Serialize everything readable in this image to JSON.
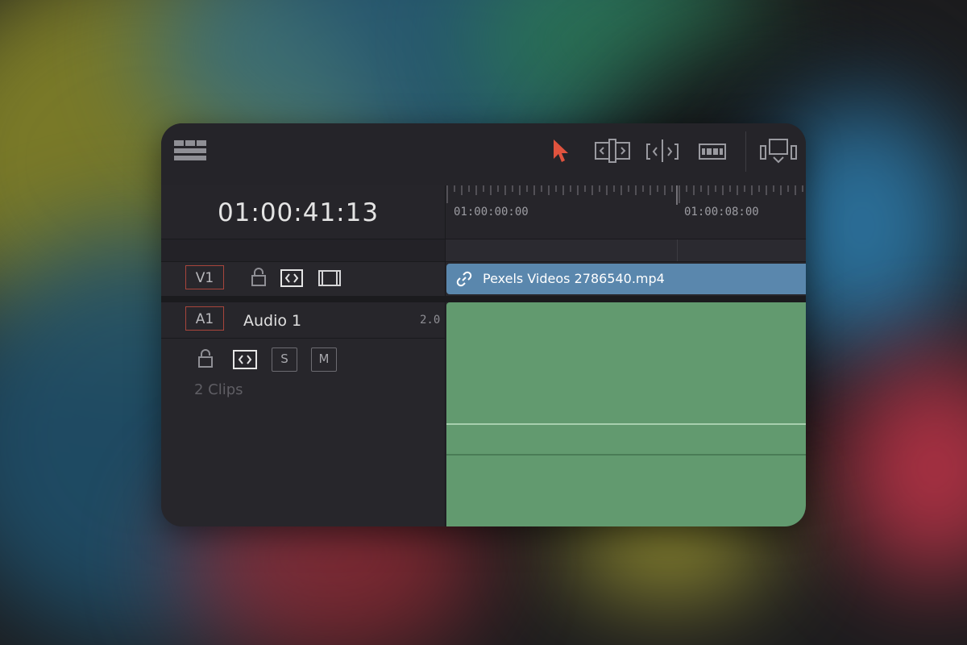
{
  "timeline": {
    "timecode": "01:00:41:13",
    "ruler_labels": [
      "01:00:00:00",
      "01:00:08:00"
    ]
  },
  "toolbar": {
    "icons": [
      "timeline-layout-icon",
      "selection-pointer-icon",
      "trim-edit-icon",
      "dynamic-trim-icon",
      "blade-icon",
      "snapping-icon"
    ],
    "pointer_color": "#e0533e"
  },
  "tracks": {
    "video": {
      "badge": "V1",
      "clip_name": "Pexels Videos 2786540.mp4",
      "clip_color": "#5a87ad"
    },
    "audio": {
      "badge": "A1",
      "name": "Audio 1",
      "channels": "2.0",
      "solo": "S",
      "mute": "M",
      "clips_count": "2 Clips",
      "clip_color": "#629a6f"
    }
  },
  "colors": {
    "badge_border": "#a8453c",
    "panel_bg": "#27262b"
  }
}
